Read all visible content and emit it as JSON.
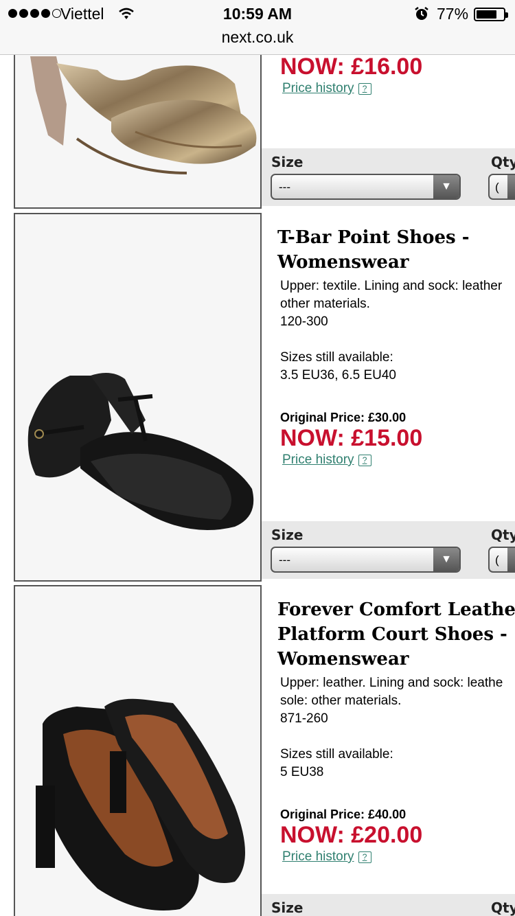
{
  "status_bar": {
    "carrier": "Viettel",
    "time": "10:59 AM",
    "battery": "77%"
  },
  "browser": {
    "url": "next.co.uk"
  },
  "labels": {
    "size": "Size",
    "qty": "Qty",
    "original_prefix": "Original Price:",
    "now_prefix": "NOW:",
    "price_history": "Price history",
    "size_placeholder": "---",
    "qty_value": "("
  },
  "products": [
    {
      "now_price": "NOW: £16.00",
      "price_history": "Price history"
    },
    {
      "title_line1": "T-Bar Point Shoes -",
      "title_line2": "Womenswear",
      "desc_line1": "Upper: textile. Lining and sock: leather",
      "desc_line2": "other materials.",
      "code": "120-300",
      "sizes_label": "Sizes still available:",
      "sizes": "3.5 EU36, 6.5 EU40",
      "original_price": "Original Price: £30.00",
      "now_price": "NOW: £15.00",
      "price_history": "Price history"
    },
    {
      "title_line1": "Forever Comfort Leather",
      "title_line2": "Platform Court Shoes -",
      "title_line3": "Womenswear",
      "desc_line1": "Upper: leather. Lining and sock: leathe",
      "desc_line2": "sole: other materials.",
      "code": "871-260",
      "sizes_label": "Sizes still available:",
      "sizes": "5 EU38",
      "original_price": "Original Price: £40.00",
      "now_price": "NOW: £20.00",
      "price_history": "Price history"
    }
  ]
}
